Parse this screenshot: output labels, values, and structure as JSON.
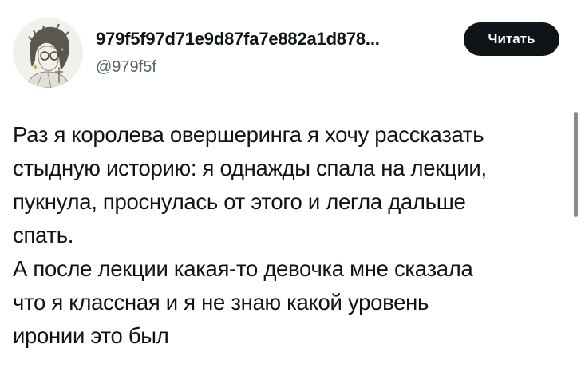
{
  "author": {
    "name": "979f5f97d71e9d87fa7e882a1d878...",
    "handle": "@979f5f",
    "avatar": "avatar-drawing"
  },
  "follow_button": {
    "label": "Читать"
  },
  "tweet": {
    "lines": [
      "Раз я королева овершеринга я хочу рассказать",
      "стыдную историю: я однажды спала на лекции,",
      "пукнула, проснулась от этого и легла дальше",
      "спать.",
      "А после лекции какая-то девочка мне сказала",
      "что я классная и я не знаю какой уровень",
      "иронии это был"
    ]
  },
  "colors": {
    "text": "#0f1419",
    "secondary": "#536471",
    "button_bg": "#0f1419",
    "button_text": "#ffffff"
  }
}
